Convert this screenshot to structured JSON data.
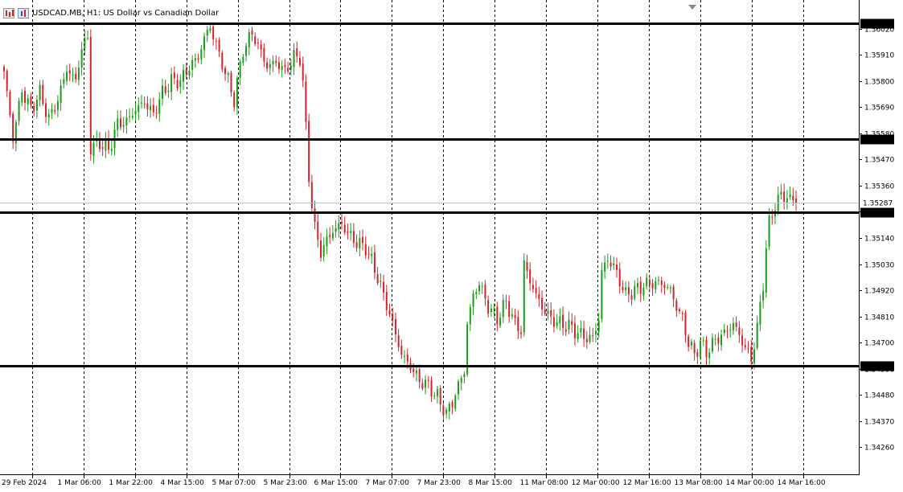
{
  "header": {
    "symbol": "USDCAD.MB",
    "timeframe": "H1",
    "description": "US Dollar vs Canadian Dollar",
    "title_text": "USDCAD.MB, H1:  US Dollar vs Canadian Dollar"
  },
  "colors": {
    "bull": "#1a9b1a",
    "bear": "#d0232a",
    "grid": "#000000",
    "hline": "#000000",
    "price_line": "#b9c3cc"
  },
  "chart_data": {
    "type": "candlestick",
    "title": "USDCAD.MB, H1:  US Dollar vs Canadian Dollar",
    "xlabel": "",
    "ylabel": "",
    "ylim": [
      1.3415,
      1.3613
    ],
    "y_ticks": [
      "1.36020",
      "1.35910",
      "1.35800",
      "1.35690",
      "1.35580",
      "1.35470",
      "1.35360",
      "1.35250",
      "1.35140",
      "1.35030",
      "1.34920",
      "1.34810",
      "1.34700",
      "1.34590",
      "1.34480",
      "1.34370",
      "1.34260"
    ],
    "x_ticks": [
      "29 Feb 2024",
      "1 Mar 06:00",
      "1 Mar 22:00",
      "4 Mar 15:00",
      "5 Mar 07:00",
      "5 Mar 23:00",
      "6 Mar 15:00",
      "7 Mar 07:00",
      "7 Mar 23:00",
      "8 Mar 15:00",
      "11 Mar 08:00",
      "12 Mar 00:00",
      "12 Mar 16:00",
      "13 Mar 08:00",
      "14 Mar 00:00",
      "14 Mar 16:00"
    ],
    "grid": "vertical dashed",
    "horizontal_levels": [
      {
        "label": "1.36041",
        "value": 1.36041
      },
      {
        "label": "1.35557",
        "value": 1.35557
      },
      {
        "label": "1.35249",
        "value": 1.35249
      },
      {
        "label": "1.34604",
        "value": 1.34604
      }
    ],
    "current_price": {
      "label": "1.35287",
      "value": 1.35287
    },
    "close_path": [
      [
        0,
        1.3584
      ],
      [
        3,
        1.3556
      ],
      [
        6,
        1.3576
      ],
      [
        9,
        1.3568
      ],
      [
        12,
        1.3575
      ],
      [
        15,
        1.3564
      ],
      [
        18,
        1.3572
      ],
      [
        21,
        1.3585
      ],
      [
        24,
        1.358
      ],
      [
        26,
        1.3594
      ],
      [
        28,
        1.3598
      ],
      [
        29,
        1.3552
      ],
      [
        32,
        1.3554
      ],
      [
        35,
        1.3551
      ],
      [
        38,
        1.3562
      ],
      [
        41,
        1.3563
      ],
      [
        44,
        1.3568
      ],
      [
        47,
        1.3571
      ],
      [
        50,
        1.3566
      ],
      [
        53,
        1.3575
      ],
      [
        56,
        1.358
      ],
      [
        59,
        1.358
      ],
      [
        62,
        1.3586
      ],
      [
        65,
        1.359
      ],
      [
        67,
        1.3598
      ],
      [
        69,
        1.3603
      ],
      [
        72,
        1.3591
      ],
      [
        75,
        1.358
      ],
      [
        77,
        1.3572
      ],
      [
        80,
        1.3593
      ],
      [
        83,
        1.36
      ],
      [
        85,
        1.3595
      ],
      [
        88,
        1.3586
      ],
      [
        91,
        1.3588
      ],
      [
        94,
        1.3584
      ],
      [
        97,
        1.359
      ],
      [
        99,
        1.359
      ],
      [
        100,
        1.3579
      ],
      [
        101,
        1.356
      ],
      [
        102,
        1.354
      ],
      [
        103,
        1.3528
      ],
      [
        104,
        1.3518
      ],
      [
        106,
        1.3508
      ],
      [
        108,
        1.3513
      ],
      [
        110,
        1.3517
      ],
      [
        113,
        1.352
      ],
      [
        115,
        1.3516
      ],
      [
        118,
        1.3512
      ],
      [
        121,
        1.351
      ],
      [
        124,
        1.3501
      ],
      [
        127,
        1.349
      ],
      [
        130,
        1.3478
      ],
      [
        133,
        1.3465
      ],
      [
        136,
        1.346
      ],
      [
        139,
        1.3454
      ],
      [
        142,
        1.3452
      ],
      [
        145,
        1.3447
      ],
      [
        148,
        1.344
      ],
      [
        150,
        1.3445
      ],
      [
        152,
        1.3452
      ],
      [
        154,
        1.3458
      ],
      [
        155,
        1.3478
      ],
      [
        157,
        1.349
      ],
      [
        159,
        1.3495
      ],
      [
        162,
        1.3485
      ],
      [
        165,
        1.348
      ],
      [
        168,
        1.3487
      ],
      [
        171,
        1.3478
      ],
      [
        173,
        1.3475
      ],
      [
        174,
        1.3503
      ],
      [
        176,
        1.3496
      ],
      [
        178,
        1.349
      ],
      [
        180,
        1.3485
      ],
      [
        183,
        1.348
      ],
      [
        186,
        1.3478
      ],
      [
        189,
        1.3477
      ],
      [
        192,
        1.3474
      ],
      [
        195,
        1.3472
      ],
      [
        197,
        1.3472
      ],
      [
        199,
        1.348
      ],
      [
        200,
        1.35
      ],
      [
        202,
        1.3505
      ],
      [
        204,
        1.3502
      ],
      [
        206,
        1.3496
      ],
      [
        208,
        1.349
      ],
      [
        211,
        1.3492
      ],
      [
        214,
        1.3494
      ],
      [
        217,
        1.3495
      ],
      [
        220,
        1.3495
      ],
      [
        223,
        1.3492
      ],
      [
        225,
        1.3485
      ],
      [
        227,
        1.348
      ],
      [
        229,
        1.347
      ],
      [
        231,
        1.3465
      ],
      [
        233,
        1.347
      ],
      [
        235,
        1.3466
      ],
      [
        238,
        1.3471
      ],
      [
        241,
        1.3474
      ],
      [
        244,
        1.3478
      ],
      [
        246,
        1.3473
      ],
      [
        248,
        1.3468
      ],
      [
        250,
        1.3463
      ],
      [
        252,
        1.3476
      ],
      [
        254,
        1.3495
      ],
      [
        255,
        1.351
      ],
      [
        256,
        1.352
      ],
      [
        258,
        1.3528
      ],
      [
        260,
        1.3532
      ],
      [
        262,
        1.3531
      ],
      [
        264,
        1.353
      ],
      [
        265,
        1.35287
      ]
    ]
  }
}
